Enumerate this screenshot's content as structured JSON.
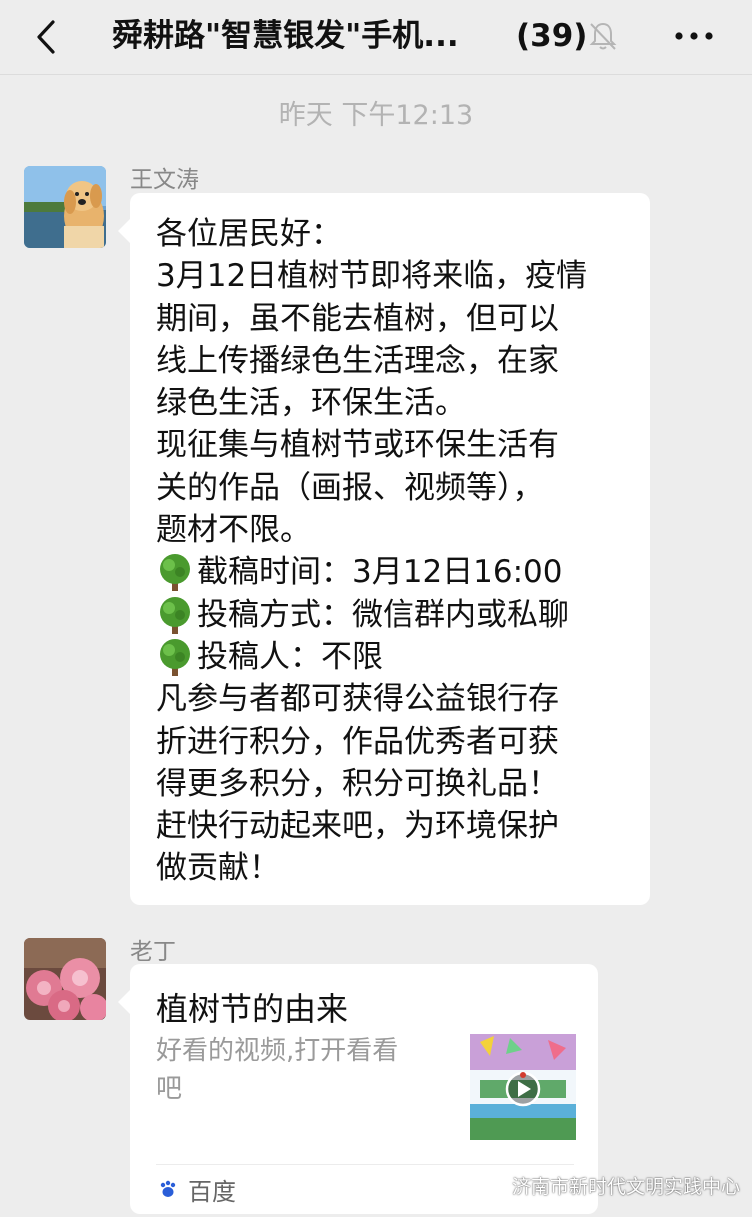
{
  "header": {
    "title": "舜耕路\"智慧银发\"手机...",
    "member_count": "(39)",
    "back_icon": "chevron-left-icon",
    "mute_icon": "bell-muted-icon",
    "more_icon": "more-dots-icon"
  },
  "timestamp": "昨天 下午12:13",
  "messages": [
    {
      "sender": "王文涛",
      "avatar_icon": "golden-retriever-avatar",
      "lines": [
        "各位居民好：",
        "3月12日植树节即将来临，疫情",
        "期间，虽不能去植树，但可以",
        "线上传播绿色生活理念，在家",
        "绿色生活，环保生活。",
        "现征集与植树节或环保生活有",
        "关的作品（画报、视频等），",
        "题材不限。",
        "截稿时间：3月12日16:00",
        "投稿方式：微信群内或私聊",
        "投稿人：不限",
        "凡参与者都可获得公益银行存",
        "折进行积分，作品优秀者可获",
        "得更多积分，积分可换礼品！",
        "赶快行动起来吧，为环境保护",
        "做贡献！"
      ],
      "bullet_icon": "tree-emoji-icon"
    },
    {
      "sender": "老丁",
      "avatar_icon": "pink-flowers-avatar",
      "card": {
        "title": "植树节的由来",
        "desc_line1": "好看的视频,打开看看",
        "desc_line2": "吧",
        "thumbnail_icon": "video-thumbnail",
        "play_icon": "play-icon",
        "source": "百度",
        "source_icon": "baidu-paw-icon"
      }
    }
  ],
  "watermark": {
    "text": "济南市新时代文明实践中心",
    "icon": "wechat-official-account-icon"
  },
  "colors": {
    "background": "#ededed",
    "bubble": "#ffffff",
    "meta_text": "#b3b3b3",
    "sender_text": "#888888"
  }
}
